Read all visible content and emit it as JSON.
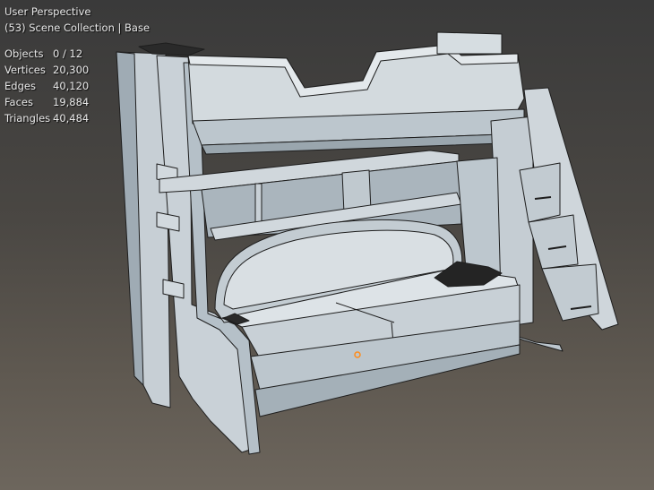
{
  "viewport": {
    "view_name": "User Perspective",
    "collection_line": "(53) Scene Collection | Base"
  },
  "stats": [
    {
      "label": "Objects",
      "value": "0 / 12"
    },
    {
      "label": "Vertices",
      "value": "20,300"
    },
    {
      "label": "Edges",
      "value": "40,120"
    },
    {
      "label": "Faces",
      "value": "19,884"
    },
    {
      "label": "Triangles",
      "value": "40,484"
    }
  ],
  "colors": {
    "model_face": "#c8d0d6",
    "model_shade": "#9aa7b0",
    "wire": "#1e1e1e",
    "origin": "#ff8c1a"
  }
}
